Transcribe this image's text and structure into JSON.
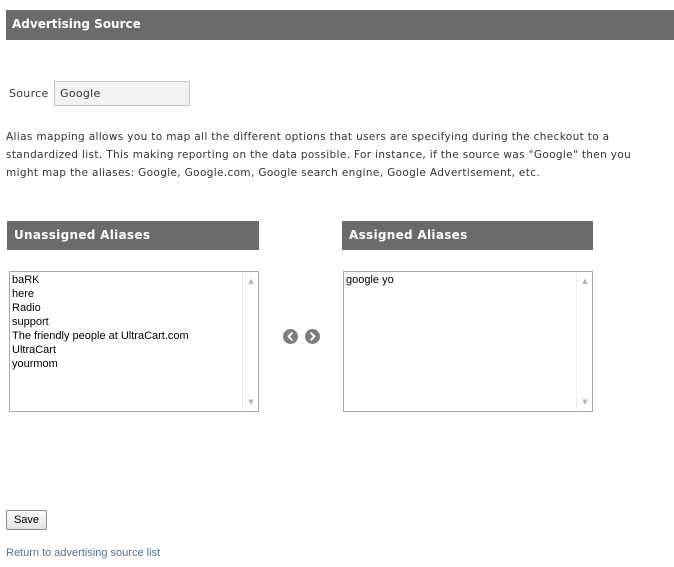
{
  "header": {
    "title": "Advertising Source"
  },
  "source": {
    "label": "Source",
    "value": "Google"
  },
  "description": "Alias mapping allows you to map all the different options that users are specifying during the checkout to a standardized list. This making reporting on the data possible. For instance, if the source was \"Google\" then you might map the aliases: Google, Google.com, Google search engine, Google Advertisement, etc.",
  "unassigned": {
    "title": "Unassigned Aliases",
    "items": [
      "baRK",
      "here",
      "Radio",
      "support",
      "The friendly people at UltraCart.com",
      "UltraCart",
      "yourmom"
    ]
  },
  "assigned": {
    "title": "Assigned Aliases",
    "items": [
      "google yo"
    ]
  },
  "controls": {
    "move_left_icon": "chevron-left-circle-icon",
    "move_right_icon": "chevron-right-circle-icon"
  },
  "actions": {
    "save_label": "Save",
    "return_link": "Return to advertising source list"
  },
  "colors": {
    "header_bg": "#6b6b6b",
    "link": "#4f7391",
    "input_bg": "#f2f2f2"
  }
}
